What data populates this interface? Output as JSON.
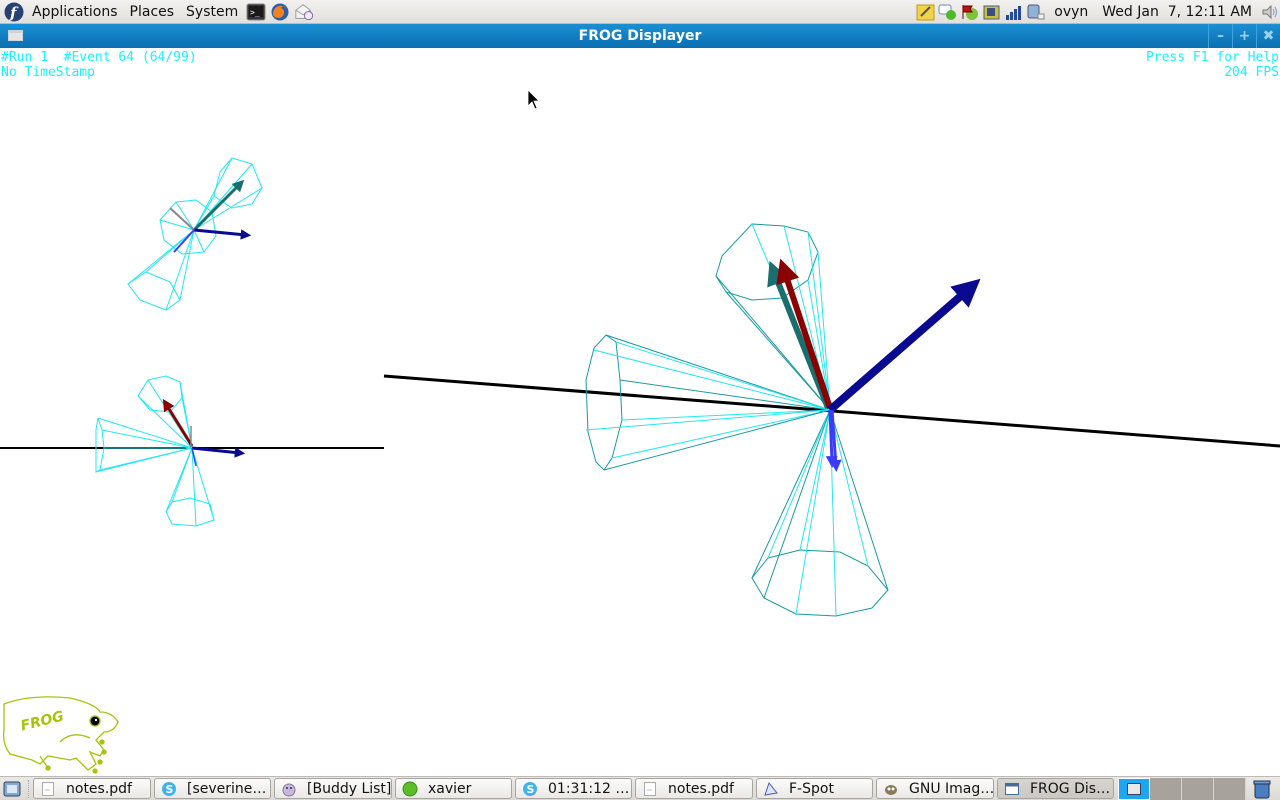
{
  "top_panel": {
    "menus": [
      "Applications",
      "Places",
      "System"
    ],
    "launchers": [
      "terminal-icon",
      "firefox-icon",
      "mail-icon"
    ],
    "tray_icons": [
      "notes-icon",
      "chat-status-icon",
      "flag-icon",
      "audio-card-icon",
      "signal-bars-icon",
      "power-icon"
    ],
    "user": "ovyn",
    "clock": "Wed Jan  7, 12:11 AM",
    "volume_icon": "speaker-icon"
  },
  "window": {
    "title": "FROG Displayer",
    "controls": {
      "minimize": "–",
      "maximize": "+",
      "close": "✖"
    }
  },
  "hud": {
    "run_event": "#Run 1  #Event 64 (64/99)",
    "timestamp": "No TimeStamp",
    "help_hint": "Press F1 for Help",
    "fps": "204 FPS"
  },
  "colors": {
    "hud_text": "#1ef0ff",
    "jet_cone": "#22e8f0",
    "jet_cone_dark": "#1a9aa0",
    "beam_axis": "#000000",
    "track_red": "#8b0000",
    "track_teal": "#1a6e6e",
    "track_blue": "#0a0a90",
    "track_light_blue": "#3b3bff",
    "logo": "#a6c40a"
  },
  "logo_text": "FROG",
  "taskbar": {
    "show_desktop_icon": "show-desktop-icon",
    "tasks": [
      {
        "label": "notes.pdf",
        "icon": "document-icon",
        "active": false
      },
      {
        "label": "[severine…",
        "icon": "skype-icon",
        "active": false
      },
      {
        "label": "[Buddy List]",
        "icon": "pidgin-icon",
        "active": false
      },
      {
        "label": "xavier",
        "icon": "status-online-icon",
        "active": false
      },
      {
        "label": "01:31:12 …",
        "icon": "skype-icon",
        "active": false
      },
      {
        "label": "notes.pdf",
        "icon": "document-icon",
        "active": false
      },
      {
        "label": "F-Spot",
        "icon": "fspot-icon",
        "active": false
      },
      {
        "label": "GNU Imag…",
        "icon": "gimp-icon",
        "active": false
      },
      {
        "label": "FROG Dis…",
        "icon": "window-icon",
        "active": true
      }
    ],
    "workspaces": 4,
    "active_workspace": 1,
    "trash_icon": "trash-icon"
  }
}
